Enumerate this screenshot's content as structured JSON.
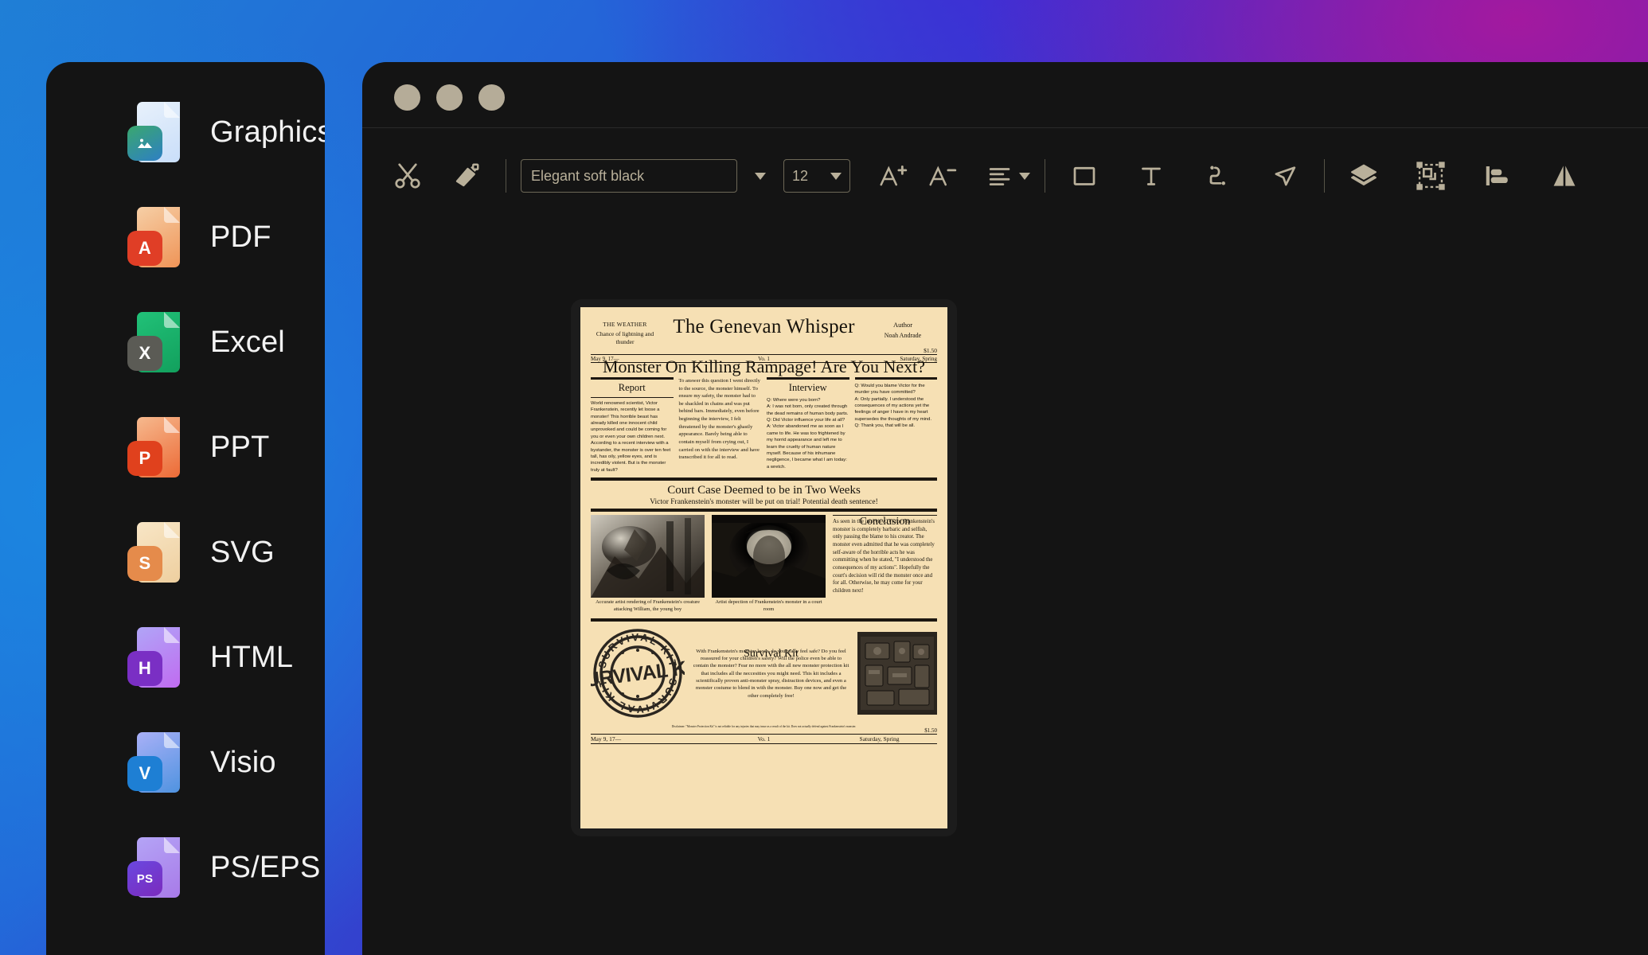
{
  "sidebar": {
    "items": [
      {
        "label": "Graphics",
        "icon": "graphics-file-icon",
        "badge": "",
        "page_color": "#dfeaf7",
        "badge_color": "#2f8fd0"
      },
      {
        "label": "PDF",
        "icon": "pdf-file-icon",
        "badge": "A",
        "page_color": "#f0a571",
        "badge_color": "#e03e26"
      },
      {
        "label": "Excel",
        "icon": "excel-file-icon",
        "badge": "X",
        "page_color": "#17b169",
        "badge_color": "#5b5b55"
      },
      {
        "label": "PPT",
        "icon": "ppt-file-icon",
        "badge": "P",
        "page_color": "#ed7140",
        "badge_color": "#e0411d"
      },
      {
        "label": "SVG",
        "icon": "svg-file-icon",
        "badge": "S",
        "page_color": "#f3dcb2",
        "badge_color": "#e58b4b"
      },
      {
        "label": "HTML",
        "icon": "html-file-icon",
        "badge": "H",
        "page_color": "#c183f2",
        "badge_color": "#7a2fc4"
      },
      {
        "label": "Visio",
        "icon": "visio-file-icon",
        "badge": "V",
        "page_color": "#8fa7f0",
        "badge_color": "#1e7fd4"
      },
      {
        "label": "PS/EPS",
        "icon": "pseps-file-icon",
        "badge": "PS",
        "page_color": "#a08bf0",
        "badge_color": "#5434c9"
      }
    ]
  },
  "window": {
    "traffic_lights": [
      "close",
      "minimize",
      "maximize"
    ]
  },
  "toolbar": {
    "cut_label": "Cut",
    "format_painter_label": "Format Painter",
    "font_name": "Elegant soft black",
    "font_name_placeholder": "Elegant soft black",
    "font_size": "12",
    "increase_font_label": "Increase Font Size",
    "decrease_font_label": "Decrease Font Size",
    "align_label": "Align",
    "shape_label": "Rectangle",
    "text_label": "Text Box",
    "connector_label": "Connector",
    "pointer_label": "Select",
    "layers_label": "Layers",
    "group_label": "Group",
    "align_left_label": "Align Left",
    "flip_label": "Flip"
  },
  "newspaper": {
    "weather_heading": "THE WEATHER",
    "weather_body": "Chance of lightning and thunder",
    "title": "The Genevan Whisper",
    "author_heading": "Author",
    "author_name": "Noah Andrade",
    "price": "$1.50",
    "dateline": {
      "date": "May 9, 17—",
      "volume": "Vo. 1",
      "day": "Saturday, Spring"
    },
    "headline": "Monster On Killing Rampage! Are You Next?",
    "report": {
      "heading": "Report",
      "body": "World renowned scientist, Victor Frankenstein, recently let loose a monster! This horrible beast has already killed one innocent child unprovoked and could be coming for you or even your own children next. According to a recent interview with a bystander, the monster is over ten feet tall, has oily, yellow eyes, and is incredibly violent. But is the monster truly at fault?"
    },
    "lead": {
      "body": "To answer this question I went directly to the source, the monster himself. To ensure my safety, the monster had to be shackled in chains and was put behind bars. Immediately, even before beginning the interview, I felt threatened by the monster's ghastly appearance. Barely being able to contain myself from crying out, I carried on with the interview and have transcribed it for all to read."
    },
    "interview": {
      "heading": "Interview",
      "body": "Q: Where were you born?\nA: I was not born, only created through the dead remains of human body parts.\nQ: Did Victor influence your life at all?\nA: Victor abandoned me as soon as I came to life. He was too frightened by my horrid appearance and left me to learn the cruelty of human nature myself. Because of his inhumane negligence, I became what I am today: a wretch."
    },
    "interview_cont": {
      "body": "Q: Would you blame Victor for the murder you have committed?\nA: Only partially. I understood the consequences of my actions yet the feelings of anger I have in my heart supersedes the thoughts of my mind.\nQ: Thank you, that will be all."
    },
    "court": {
      "title": "Court Case Deemed to be in Two Weeks",
      "subtitle": "Victor Frankenstein's monster will be put on trial! Potential death sentence!"
    },
    "figures": [
      {
        "caption": "Accurate artist rendering of Frankenstein's creature attacking William, the young boy",
        "alt": "engraving-creature-attacking-william"
      },
      {
        "caption": "Artist depection of Frankenstein's monster in a court room",
        "alt": "engraving-monster-in-courtroom"
      }
    ],
    "conclusion": {
      "heading": "Conclusion",
      "body": "As seen in the interview, Victor Frankenstein's monster is completely barbaric and selfish, only passing the blame to his creator. The monster even admitted that he was completely self-aware of the horrible acts he was committing when he stated, \"I understood the consequences of my actions\". Hopefully the court's decision will rid the monster once and for all. Otherwise, he may come for your children next!"
    },
    "kit": {
      "heading": "Survival Kit",
      "stamp_text": "SURVIVAL KIT",
      "body": "With Frankenstein's monster loose, do you really feel safe? Do you feel reassured for your children's safety? Will the police even be able to contain the monster? Fear no more with the all new monster protection kit that includes all the neccesities you might need. This kit includes a scientifically proven anti-monster spray, distraction devices, and even a monster costume to blend in with the monster. Buy one now and get the other completely free!",
      "photo_alt": "survival-kit-contents-photo"
    },
    "disclaimer": "Disclaimer: \"Monster Protection Kit\" is not reliable for any injuries that may insue as a result of the kit. Does not actually defend against Frankenstein's monster.",
    "footer": {
      "date": "May 9, 17—",
      "volume": "Vo. 1",
      "day": "Saturday, Spring",
      "price": "$1.50"
    }
  },
  "colors": {
    "paper": "#f6e0b4",
    "ink": "#17130c",
    "toolbar_icon": "#b9b09a",
    "window_bg": "#141414"
  }
}
